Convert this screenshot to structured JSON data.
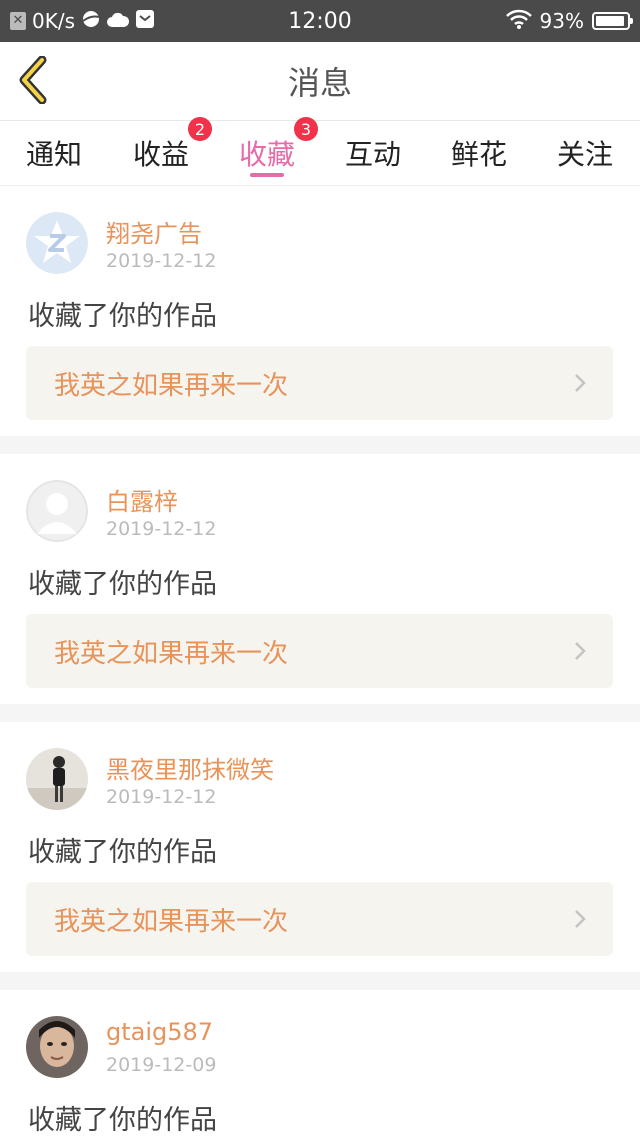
{
  "status_bar": {
    "speed": "0K/s",
    "time": "12:00",
    "battery": "93%",
    "battery_level": 0.93
  },
  "header": {
    "title": "消息"
  },
  "tabs": [
    {
      "label": "通知",
      "badge": null,
      "active": false
    },
    {
      "label": "收益",
      "badge": "2",
      "active": false
    },
    {
      "label": "收藏",
      "badge": "3",
      "active": true
    },
    {
      "label": "互动",
      "badge": null,
      "active": false
    },
    {
      "label": "鲜花",
      "badge": null,
      "active": false
    },
    {
      "label": "关注",
      "badge": null,
      "active": false
    }
  ],
  "colors": {
    "accent": "#e86aa8",
    "username": "#e8935a",
    "badge": "#f0324a"
  },
  "messages": [
    {
      "user": "翔尧广告",
      "date": "2019-12-12",
      "action": "收藏了你的作品",
      "work": "我英之如果再来一次",
      "avatar": "default-z-icon"
    },
    {
      "user": "白露梓",
      "date": "2019-12-12",
      "action": "收藏了你的作品",
      "work": "我英之如果再来一次",
      "avatar": "default-person-icon"
    },
    {
      "user": "黑夜里那抹微笑",
      "date": "2019-12-12",
      "action": "收藏了你的作品",
      "work": "我英之如果再来一次",
      "avatar": "photo-person"
    },
    {
      "user": "gtaig587",
      "date": "2019-12-09",
      "action": "收藏了你的作品",
      "work": "",
      "avatar": "photo-face"
    }
  ]
}
